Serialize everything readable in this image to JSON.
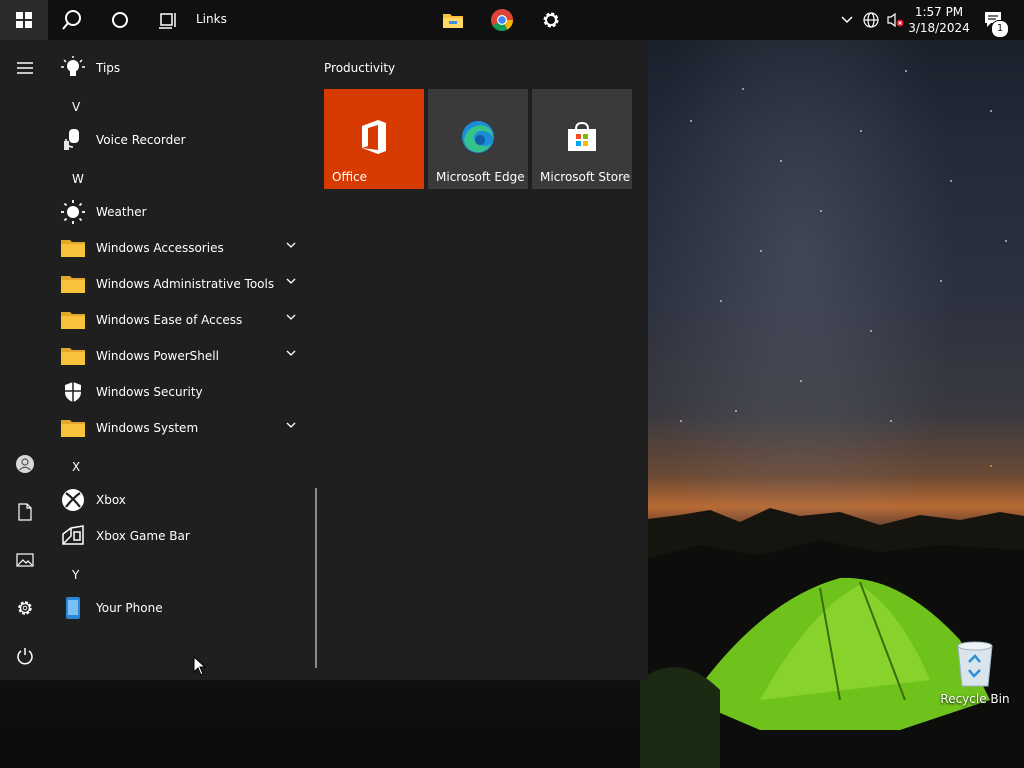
{
  "taskbar": {
    "links_label": "Links",
    "clock_time": "1:57 PM",
    "clock_date": "3/18/2024",
    "notification_count": "1",
    "icons": [
      "windows-start-icon",
      "search-icon",
      "cortana-icon",
      "task-view-icon",
      "file-explorer-icon",
      "chrome-icon",
      "settings-icon",
      "chevron-up-icon",
      "network-globe-icon",
      "volume-muted-icon",
      "action-center-icon"
    ]
  },
  "start_menu": {
    "rail_icons": [
      "hamburger-menu-icon",
      "user-icon",
      "documents-icon",
      "pictures-icon",
      "settings-icon",
      "power-icon"
    ],
    "apps": {
      "tips": "Tips",
      "letter_v": "V",
      "voice_recorder": "Voice Recorder",
      "letter_w": "W",
      "weather": "Weather",
      "windows_accessories": "Windows Accessories",
      "windows_admin_tools": "Windows Administrative Tools",
      "windows_ease": "Windows Ease of Access",
      "windows_powershell": "Windows PowerShell",
      "windows_security": "Windows Security",
      "windows_system": "Windows System",
      "letter_x": "X",
      "xbox": "Xbox",
      "xbox_game_bar": "Xbox Game Bar",
      "letter_y": "Y",
      "your_phone": "Your Phone"
    },
    "tiles": {
      "group_header": "Productivity",
      "office": "Office",
      "edge": "Microsoft Edge",
      "store": "Microsoft Store"
    }
  },
  "desktop": {
    "recycle_bin_label": "Recycle Bin"
  },
  "colors": {
    "office_tile": "#d83b01",
    "tile_gray": "#3a3a3a",
    "folder_yellow": "#f8c33b",
    "start_bg": "#1f1f1f",
    "taskbar_bg": "#101010"
  }
}
